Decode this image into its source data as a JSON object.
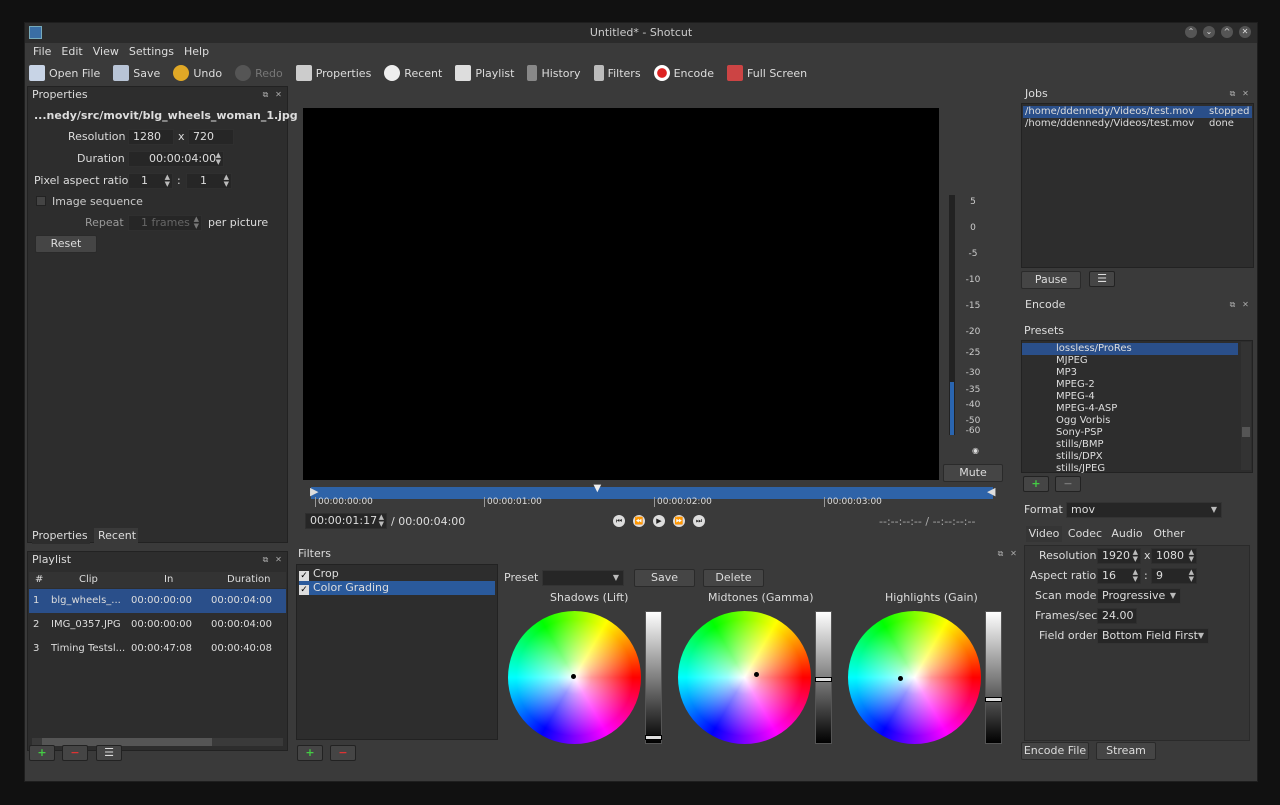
{
  "window": {
    "title": "Untitled* - Shotcut"
  },
  "menu": [
    "File",
    "Edit",
    "View",
    "Settings",
    "Help"
  ],
  "toolbar": {
    "open": "Open File",
    "save": "Save",
    "undo": "Undo",
    "redo": "Redo",
    "properties": "Properties",
    "recent": "Recent",
    "playlist": "Playlist",
    "history": "History",
    "filters": "Filters",
    "encode": "Encode",
    "fullscreen": "Full Screen"
  },
  "properties": {
    "title": "Properties",
    "filename": "...nedy/src/movit/blg_wheels_woman_1.jpg",
    "resolution_label": "Resolution",
    "res_w": "1280",
    "res_x": "x",
    "res_h": "720",
    "duration_label": "Duration",
    "duration": "00:00:04:00",
    "par_label": "Pixel aspect ratio",
    "par_num": "1",
    "par_sep": ":",
    "par_den": "1",
    "image_seq_label": "Image sequence",
    "repeat_label": "Repeat",
    "repeat_value": "1 frames",
    "per_picture": "per picture",
    "reset": "Reset",
    "tab_properties": "Properties",
    "tab_recent": "Recent"
  },
  "player": {
    "meter_ticks": [
      "5",
      "0",
      "-5",
      "-10",
      "-15",
      "-20",
      "-25",
      "-30",
      "-35",
      "-40",
      "-50",
      "-60"
    ],
    "mute": "Mute",
    "timeline_marks": [
      "00:00:00:00",
      "00:00:01:00",
      "00:00:02:00",
      "00:00:03:00"
    ],
    "playhead_fraction": 0.42,
    "current": "00:00:01:17",
    "total": "/ 00:00:04:00",
    "inout": "--:--:--:-- / --:--:--:--"
  },
  "playlist": {
    "title": "Playlist",
    "headers": [
      "#",
      "Clip",
      "In",
      "Duration"
    ],
    "rows": [
      {
        "num": "1",
        "clip": "blg_wheels_...",
        "in": "00:00:00:00",
        "dur": "00:00:04:00"
      },
      {
        "num": "2",
        "clip": "IMG_0357.JPG",
        "in": "00:00:00:00",
        "dur": "00:00:04:00"
      },
      {
        "num": "3",
        "clip": "Timing Testsl...",
        "in": "00:00:47:08",
        "dur": "00:00:40:08"
      }
    ]
  },
  "filters": {
    "title": "Filters",
    "items": [
      "Crop",
      "Color Grading"
    ],
    "preset_label": "Preset",
    "save": "Save",
    "delete": "Delete",
    "shadows": "Shadows (Lift)",
    "midtones": "Midtones (Gamma)",
    "highlights": "Highlights (Gain)"
  },
  "jobs": {
    "title": "Jobs",
    "rows": [
      {
        "path": "/home/ddennedy/Videos/test.mov",
        "status": "stopped"
      },
      {
        "path": "/home/ddennedy/Videos/test.mov",
        "status": "done"
      }
    ],
    "pause": "Pause"
  },
  "encode": {
    "title": "Encode",
    "presets_label": "Presets",
    "presets": [
      "lossless/ProRes",
      "MJPEG",
      "MP3",
      "MPEG-2",
      "MPEG-4",
      "MPEG-4-ASP",
      "Ogg Vorbis",
      "Sony-PSP",
      "stills/BMP",
      "stills/DPX",
      "stills/JPEG"
    ],
    "format_label": "Format",
    "format": "mov",
    "tabs": [
      "Video",
      "Codec",
      "Audio",
      "Other"
    ],
    "resolution_label": "Resolution",
    "res_w": "1920",
    "res_x": "x",
    "res_h": "1080",
    "aspect_label": "Aspect ratio",
    "aspect_w": "16",
    "aspect_sep": ":",
    "aspect_h": "9",
    "scan_label": "Scan mode",
    "scan": "Progressive",
    "fps_label": "Frames/sec",
    "fps": "24.00",
    "field_label": "Field order",
    "field": "Bottom Field First",
    "encode_file": "Encode File",
    "stream": "Stream"
  }
}
